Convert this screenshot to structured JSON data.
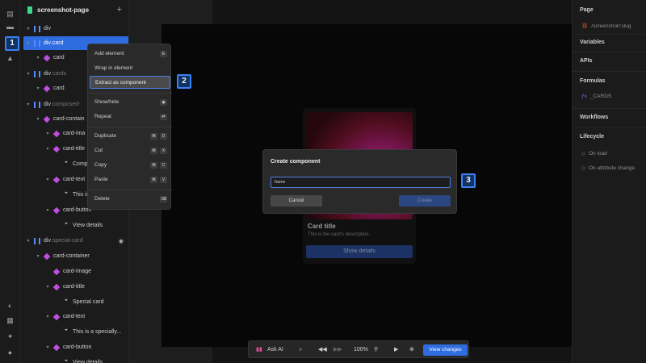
{
  "project": {
    "name": "screenshot-page"
  },
  "layers": [
    {
      "label": "div",
      "suffix": "",
      "type": "div",
      "depth": 0,
      "chev": "▾"
    },
    {
      "label": "div",
      "suffix": ".card",
      "type": "div",
      "depth": 0,
      "chev": "▾",
      "selected": true
    },
    {
      "label": "card",
      "suffix": "",
      "type": "comp",
      "depth": 1,
      "chev": "▾"
    },
    {
      "label": "div",
      "suffix": ".cards",
      "type": "div",
      "depth": 0,
      "chev": "▾"
    },
    {
      "label": "card",
      "suffix": "",
      "type": "comp",
      "depth": 1,
      "chev": "▾"
    },
    {
      "label": "div",
      "suffix": ".composed-",
      "type": "div",
      "depth": 0,
      "chev": "▾"
    },
    {
      "label": "card-contain",
      "suffix": "",
      "type": "comp",
      "depth": 1,
      "chev": "▾"
    },
    {
      "label": "card-ima",
      "suffix": "",
      "type": "comp",
      "depth": 2,
      "chev": "▾"
    },
    {
      "label": "card-title",
      "suffix": "",
      "type": "comp",
      "depth": 2,
      "chev": "▾"
    },
    {
      "label": "Compo",
      "suffix": "",
      "type": "quote",
      "depth": 3,
      "chev": ""
    },
    {
      "label": "card-text",
      "suffix": "",
      "type": "comp",
      "depth": 2,
      "chev": "▾"
    },
    {
      "label": "This is",
      "suffix": "",
      "type": "quote",
      "depth": 3,
      "chev": ""
    },
    {
      "label": "card-button",
      "suffix": "",
      "type": "comp",
      "depth": 2,
      "chev": "▾"
    },
    {
      "label": "View details",
      "suffix": "",
      "type": "quote",
      "depth": 3,
      "chev": ""
    },
    {
      "label": "div",
      "suffix": ".special-card",
      "type": "div",
      "depth": 0,
      "chev": "▾",
      "eye": true
    },
    {
      "label": "card-container",
      "suffix": "",
      "type": "comp",
      "depth": 1,
      "chev": "▾"
    },
    {
      "label": "card-image",
      "suffix": "",
      "type": "comp",
      "depth": 2,
      "chev": ""
    },
    {
      "label": "card-title",
      "suffix": "",
      "type": "comp",
      "depth": 2,
      "chev": "▾"
    },
    {
      "label": "Special card",
      "suffix": "",
      "type": "quote",
      "depth": 3,
      "chev": ""
    },
    {
      "label": "card-text",
      "suffix": "",
      "type": "comp",
      "depth": 2,
      "chev": "▾"
    },
    {
      "label": "This is a specially...",
      "suffix": "",
      "type": "quote",
      "depth": 3,
      "chev": ""
    },
    {
      "label": "card-button",
      "suffix": "",
      "type": "comp",
      "depth": 2,
      "chev": "▾"
    },
    {
      "label": "View details",
      "suffix": "",
      "type": "quote",
      "depth": 3,
      "chev": ""
    }
  ],
  "context_menu": {
    "items": [
      {
        "label": "Add element",
        "keys": [
          "E"
        ]
      },
      {
        "label": "Wrap in element",
        "keys": []
      },
      {
        "label": "Extract as component",
        "keys": [],
        "highlight": true
      },
      {
        "label": "Show/hide",
        "keys": [
          "◉"
        ]
      },
      {
        "label": "Repeat",
        "keys": [
          "⇄"
        ]
      },
      {
        "label": "Duplicate",
        "keys": [
          "⌘",
          "D"
        ]
      },
      {
        "label": "Cut",
        "keys": [
          "⌘",
          "X"
        ]
      },
      {
        "label": "Copy",
        "keys": [
          "⌘",
          "C"
        ]
      },
      {
        "label": "Paste",
        "keys": [
          "⌘",
          "V"
        ]
      },
      {
        "label": "Delete",
        "keys": [
          "⌫"
        ]
      }
    ]
  },
  "preview_card": {
    "title": "Card title",
    "description": "This is the card's description.",
    "button": "Show details"
  },
  "dialog": {
    "title": "Create component",
    "input_value": "Name",
    "cancel": "Cancel",
    "create": "Create"
  },
  "callouts": [
    "1",
    "2",
    "3"
  ],
  "right_panel": {
    "page_label": "Page",
    "page_value": "/screenshot/:slug",
    "variables_label": "Variables",
    "apis_label": "APIs",
    "formulas_label": "Formulas",
    "formula_value": "_CARDS",
    "workflows_label": "Workflows",
    "lifecycle_label": "Lifecycle",
    "lifecycle_items": [
      "On load",
      "On attribute change"
    ]
  },
  "toolbar": {
    "ask_ai": "Ask AI",
    "zoom": "100%",
    "view_changes": "View changes"
  },
  "colors": {
    "accent": "#2e6ce0",
    "component": "#c04fe0",
    "callout_border": "#3b82f6"
  }
}
